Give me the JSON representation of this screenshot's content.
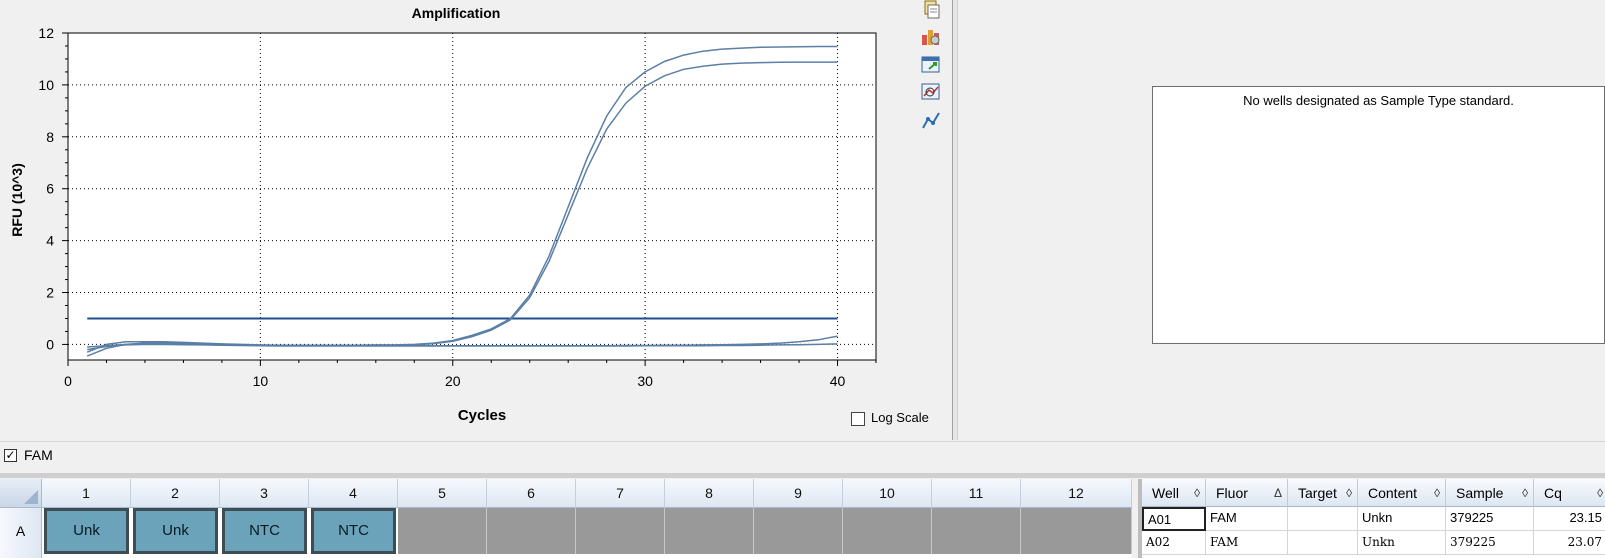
{
  "chart": {
    "log_scale_label": "Log Scale",
    "log_scale_checked": false
  },
  "chart_data": {
    "type": "line",
    "title": "Amplification",
    "xlabel": "Cycles",
    "ylabel": "RFU (10^3)",
    "xlim": [
      0,
      42
    ],
    "ylim": [
      -0.6,
      12
    ],
    "xticks": [
      0,
      10,
      20,
      30,
      40
    ],
    "yticks": [
      0,
      2,
      4,
      6,
      8,
      10,
      12
    ],
    "grid": true,
    "threshold": 1.0,
    "series": [
      {
        "x": [
          1,
          2,
          3,
          4,
          5,
          6,
          7,
          8,
          9,
          10,
          11,
          12,
          13,
          14,
          15,
          16,
          17,
          18,
          19,
          20,
          21,
          22,
          23,
          24,
          25,
          26,
          27,
          28,
          29,
          30,
          31,
          32,
          33,
          34,
          35,
          36,
          37,
          38,
          39,
          40
        ],
        "values": [
          -0.3,
          0.0,
          0.1,
          0.1,
          0.1,
          0.08,
          0.05,
          0.02,
          0.0,
          -0.02,
          -0.03,
          -0.03,
          -0.03,
          -0.03,
          -0.03,
          -0.02,
          -0.02,
          0.0,
          0.05,
          0.15,
          0.35,
          0.6,
          1.0,
          1.9,
          3.4,
          5.3,
          7.2,
          8.8,
          9.9,
          10.5,
          10.9,
          11.15,
          11.3,
          11.38,
          11.42,
          11.45,
          11.46,
          11.47,
          11.48,
          11.48
        ]
      },
      {
        "x": [
          1,
          2,
          3,
          4,
          5,
          6,
          7,
          8,
          9,
          10,
          11,
          12,
          13,
          14,
          15,
          16,
          17,
          18,
          19,
          20,
          21,
          22,
          23,
          24,
          25,
          26,
          27,
          28,
          29,
          30,
          31,
          32,
          33,
          34,
          35,
          36,
          37,
          38,
          39,
          40
        ],
        "values": [
          -0.45,
          -0.15,
          0.0,
          0.05,
          0.05,
          0.04,
          0.02,
          0.0,
          -0.02,
          -0.03,
          -0.04,
          -0.04,
          -0.04,
          -0.04,
          -0.04,
          -0.03,
          -0.03,
          -0.01,
          0.03,
          0.12,
          0.3,
          0.55,
          0.95,
          1.8,
          3.2,
          5.0,
          6.8,
          8.3,
          9.3,
          9.95,
          10.35,
          10.6,
          10.72,
          10.8,
          10.84,
          10.86,
          10.87,
          10.88,
          10.88,
          10.88
        ]
      },
      {
        "x": [
          1,
          2,
          3,
          4,
          5,
          6,
          7,
          8,
          9,
          10,
          11,
          12,
          13,
          14,
          15,
          16,
          17,
          18,
          19,
          20,
          21,
          22,
          23,
          24,
          25,
          26,
          27,
          28,
          29,
          30,
          31,
          32,
          33,
          34,
          35,
          36,
          37,
          38,
          39,
          40
        ],
        "values": [
          -0.1,
          -0.05,
          0.0,
          0.0,
          0.0,
          0.0,
          -0.01,
          -0.02,
          -0.03,
          -0.04,
          -0.05,
          -0.05,
          -0.05,
          -0.05,
          -0.05,
          -0.05,
          -0.05,
          -0.05,
          -0.05,
          -0.05,
          -0.05,
          -0.05,
          -0.05,
          -0.05,
          -0.05,
          -0.05,
          -0.05,
          -0.05,
          -0.04,
          -0.04,
          -0.03,
          -0.03,
          -0.02,
          -0.01,
          0.0,
          0.02,
          0.05,
          0.1,
          0.18,
          0.32
        ]
      },
      {
        "x": [
          1,
          2,
          3,
          4,
          5,
          6,
          7,
          8,
          9,
          10,
          11,
          12,
          13,
          14,
          15,
          16,
          17,
          18,
          19,
          20,
          21,
          22,
          23,
          24,
          25,
          26,
          27,
          28,
          29,
          30,
          31,
          32,
          33,
          34,
          35,
          36,
          37,
          38,
          39,
          40
        ],
        "values": [
          -0.2,
          -0.08,
          -0.02,
          0.0,
          0.0,
          -0.01,
          -0.02,
          -0.03,
          -0.04,
          -0.05,
          -0.06,
          -0.06,
          -0.06,
          -0.06,
          -0.06,
          -0.06,
          -0.06,
          -0.06,
          -0.06,
          -0.06,
          -0.06,
          -0.06,
          -0.06,
          -0.06,
          -0.06,
          -0.06,
          -0.06,
          -0.06,
          -0.06,
          -0.05,
          -0.05,
          -0.05,
          -0.05,
          -0.04,
          -0.04,
          -0.03,
          -0.02,
          -0.01,
          0.0,
          0.02
        ]
      }
    ],
    "colors": {
      "curve": "#5b7fa6",
      "threshold": "#1f4e8c"
    }
  },
  "standard_curve": {
    "message": "No wells designated as Sample Type standard."
  },
  "fluor_filter": {
    "label": "FAM",
    "checked": true
  },
  "plate": {
    "columns": [
      "1",
      "2",
      "3",
      "4",
      "5",
      "6",
      "7",
      "8",
      "9",
      "10",
      "11",
      "12"
    ],
    "rows": [
      "A"
    ],
    "wells": [
      "Unk",
      "Unk",
      "NTC",
      "NTC",
      "",
      "",
      "",
      "",
      "",
      "",
      "",
      ""
    ]
  },
  "results_table": {
    "headers": [
      {
        "label": "Well",
        "sort": "◊"
      },
      {
        "label": "Fluor",
        "sort": "Δ"
      },
      {
        "label": "Target",
        "sort": "◊"
      },
      {
        "label": "Content",
        "sort": "◊"
      },
      {
        "label": "Sample",
        "sort": "◊"
      },
      {
        "label": "Cq",
        "sort": "◊"
      }
    ],
    "rows": [
      [
        "A01",
        "FAM",
        "",
        "Unkn",
        "379225",
        "23.15"
      ],
      [
        "A02",
        "FAM",
        "",
        "Unkn",
        "379225",
        "23.07"
      ]
    ]
  }
}
